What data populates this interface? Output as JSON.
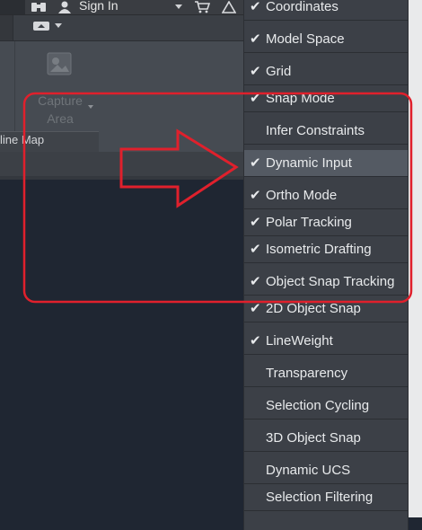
{
  "header": {
    "signin_label": "Sign In"
  },
  "ribbon": {
    "capture_label_line1": "Capture",
    "capture_label_line2": "Area",
    "panel_label": "line Map"
  },
  "menu": {
    "items": [
      {
        "label": "Coordinates",
        "checked": true,
        "check": "✔"
      },
      {
        "label": "Model Space",
        "checked": true,
        "check": "✔"
      },
      {
        "label": "Grid",
        "checked": true,
        "check": "✔"
      },
      {
        "label": "Snap Mode",
        "checked": true,
        "check": "✔"
      },
      {
        "label": "Infer Constraints",
        "checked": false,
        "check": ""
      },
      {
        "label": "Dynamic Input",
        "checked": true,
        "check": "✔",
        "highlighted": true
      },
      {
        "label": "Ortho Mode",
        "checked": true,
        "check": "✔"
      },
      {
        "label": "Polar Tracking",
        "checked": true,
        "check": "✔"
      },
      {
        "label": "Isometric Drafting",
        "checked": true,
        "check": "✔"
      },
      {
        "label": "Object Snap Tracking",
        "checked": true,
        "check": "✔"
      },
      {
        "label": "2D Object Snap",
        "checked": true,
        "check": "✔"
      },
      {
        "label": "LineWeight",
        "checked": true,
        "check": "✔"
      },
      {
        "label": "Transparency",
        "checked": false,
        "check": ""
      },
      {
        "label": "Selection Cycling",
        "checked": false,
        "check": ""
      },
      {
        "label": "3D Object Snap",
        "checked": false,
        "check": ""
      },
      {
        "label": "Dynamic UCS",
        "checked": false,
        "check": ""
      },
      {
        "label": "Selection Filtering",
        "checked": false,
        "check": ""
      }
    ]
  },
  "colors": {
    "annotation": "#e0202c",
    "menu_bg": "#3c4047",
    "menu_highlight": "#545a63",
    "canvas": "#1f2632"
  },
  "icons": {
    "binoculars": "binoculars-icon",
    "user": "user-icon",
    "cart": "cart-icon",
    "capture": "capture-area-icon"
  }
}
